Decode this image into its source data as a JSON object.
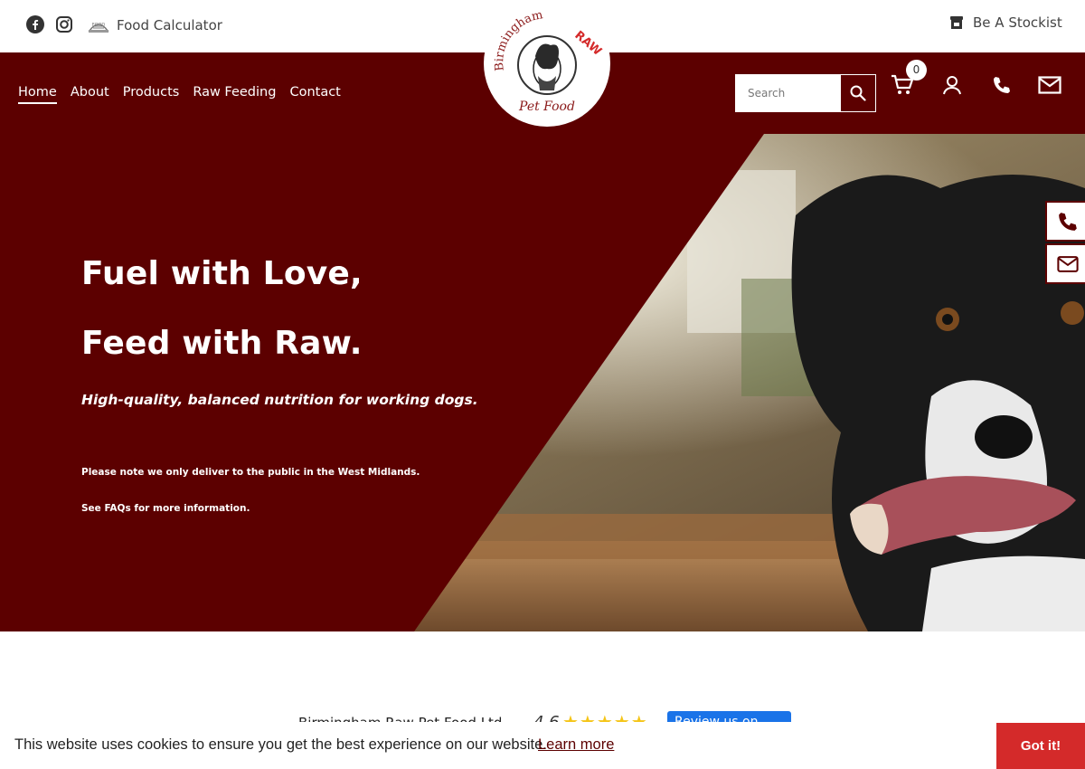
{
  "topbar": {
    "social_icons": [
      "facebook-icon",
      "instagram-icon"
    ],
    "food_calculator_label": "Food Calculator",
    "stockist_label": "Be A Stockist"
  },
  "nav": {
    "items": [
      {
        "label": "Home",
        "active": true
      },
      {
        "label": "About",
        "active": false
      },
      {
        "label": "Products",
        "active": false
      },
      {
        "label": "Raw Feeding",
        "active": false
      },
      {
        "label": "Contact",
        "active": false
      }
    ]
  },
  "search": {
    "placeholder": "Search"
  },
  "cart": {
    "count": "0"
  },
  "logo": {
    "top_text": "Birmingham",
    "accent_text": "RAW",
    "bottom_text": "Pet Food"
  },
  "hero": {
    "title_line1": "Fuel with Love,",
    "title_line2": "Feed with Raw.",
    "subtitle": "High-quality, balanced nutrition for working dogs.",
    "note1": "Please note we only deliver to the public in the West Midlands.",
    "note2": "See FAQs for more information."
  },
  "reviews": {
    "company": "Birmingham Raw Pet Food Ltd",
    "score": "4.6",
    "stars": "★★★★★",
    "button_label": "Review us on"
  },
  "cookie": {
    "text": "This website uses cookies to ensure you get the best experience on our website.",
    "link": "Learn more",
    "button": "Got it!"
  },
  "colors": {
    "brand": "#5c0000",
    "cookie_button": "#d42a2a",
    "review_button": "#1a73e8"
  }
}
